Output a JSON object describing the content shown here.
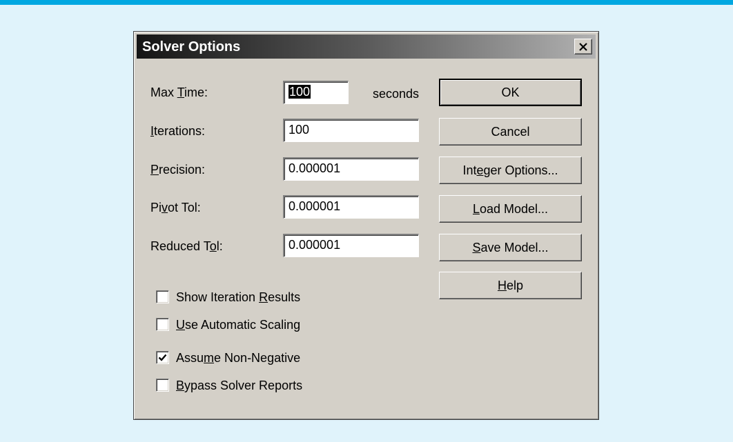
{
  "dialog": {
    "title": "Solver Options",
    "fields": {
      "max_time": {
        "label_before": "Max ",
        "label_mn": "T",
        "label_after": "ime:",
        "value": "100",
        "units": "seconds"
      },
      "iterations": {
        "label_before": "",
        "label_mn": "I",
        "label_after": "terations:",
        "value": "100"
      },
      "precision": {
        "label_before": "",
        "label_mn": "P",
        "label_after": "recision:",
        "value": "0.000001"
      },
      "pivot_tol": {
        "label_before": "Pi",
        "label_mn": "v",
        "label_after": "ot Tol:",
        "value": "0.000001"
      },
      "reduced_tol": {
        "label_before": "Reduced T",
        "label_mn": "o",
        "label_after": "l:",
        "value": "0.000001"
      }
    },
    "checkboxes": {
      "show_iteration": {
        "before": "Show Iteration ",
        "mn": "R",
        "after": "esults",
        "checked": false
      },
      "automatic_scaling": {
        "before": "",
        "mn": "U",
        "after": "se Automatic Scaling",
        "checked": false
      },
      "non_negative": {
        "before": "Assu",
        "mn": "m",
        "after": "e Non-Negative",
        "checked": true
      },
      "bypass_reports": {
        "before": "",
        "mn": "B",
        "after": "ypass Solver Reports",
        "checked": false
      }
    },
    "buttons": {
      "ok": {
        "before": "OK",
        "mn": "",
        "after": ""
      },
      "cancel": {
        "before": "Cancel",
        "mn": "",
        "after": ""
      },
      "integer": {
        "before": "Int",
        "mn": "e",
        "after": "ger Options..."
      },
      "load": {
        "before": "",
        "mn": "L",
        "after": "oad Model..."
      },
      "save": {
        "before": "",
        "mn": "S",
        "after": "ave Model..."
      },
      "help": {
        "before": "",
        "mn": "H",
        "after": "elp"
      }
    }
  },
  "colors": {
    "desktop": "#e0f3fb",
    "accent_bar": "#00a7e1",
    "dialog_face": "#d4d0c8",
    "title_gradient_start": "#151515",
    "title_gradient_end": "#b2b2b2"
  },
  "icons": {
    "close": "close-icon",
    "check": "check-icon"
  }
}
